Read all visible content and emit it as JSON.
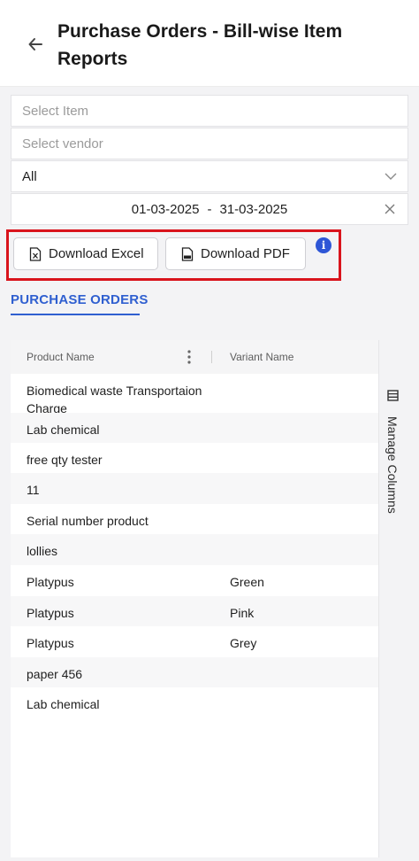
{
  "header": {
    "title": "Purchase Orders - Bill-wise Item Reports",
    "back_icon": "arrow-left-icon"
  },
  "filters": {
    "item_placeholder": "Select Item",
    "vendor_placeholder": "Select vendor",
    "status_value": "All",
    "date_start": "01-03-2025",
    "date_separator": "-",
    "date_end": "31-03-2025"
  },
  "actions": {
    "download_excel_label": "Download Excel",
    "download_pdf_label": "Download PDF",
    "info_glyph": "i"
  },
  "tabs": [
    {
      "label": "PURCHASE ORDERS",
      "active": true
    }
  ],
  "table": {
    "columns": [
      "Product Name",
      "Variant Name"
    ],
    "rows": [
      {
        "product": "Biomedical waste Transportaion Charge",
        "variant": ""
      },
      {
        "product": "Lab chemical",
        "variant": ""
      },
      {
        "product": "free qty tester",
        "variant": ""
      },
      {
        "product": "11",
        "variant": ""
      },
      {
        "product": "Serial number product",
        "variant": ""
      },
      {
        "product": "lollies",
        "variant": ""
      },
      {
        "product": "Platypus",
        "variant": "Green"
      },
      {
        "product": "Platypus",
        "variant": "Pink"
      },
      {
        "product": "Platypus",
        "variant": "Grey"
      },
      {
        "product": "paper 456",
        "variant": ""
      },
      {
        "product": "Lab chemical",
        "variant": ""
      }
    ]
  },
  "side_panel": {
    "manage_columns_label": "Manage Columns"
  },
  "colors": {
    "accent": "#2f5fd0",
    "highlight": "#d9141c",
    "info": "#2e56d6"
  }
}
